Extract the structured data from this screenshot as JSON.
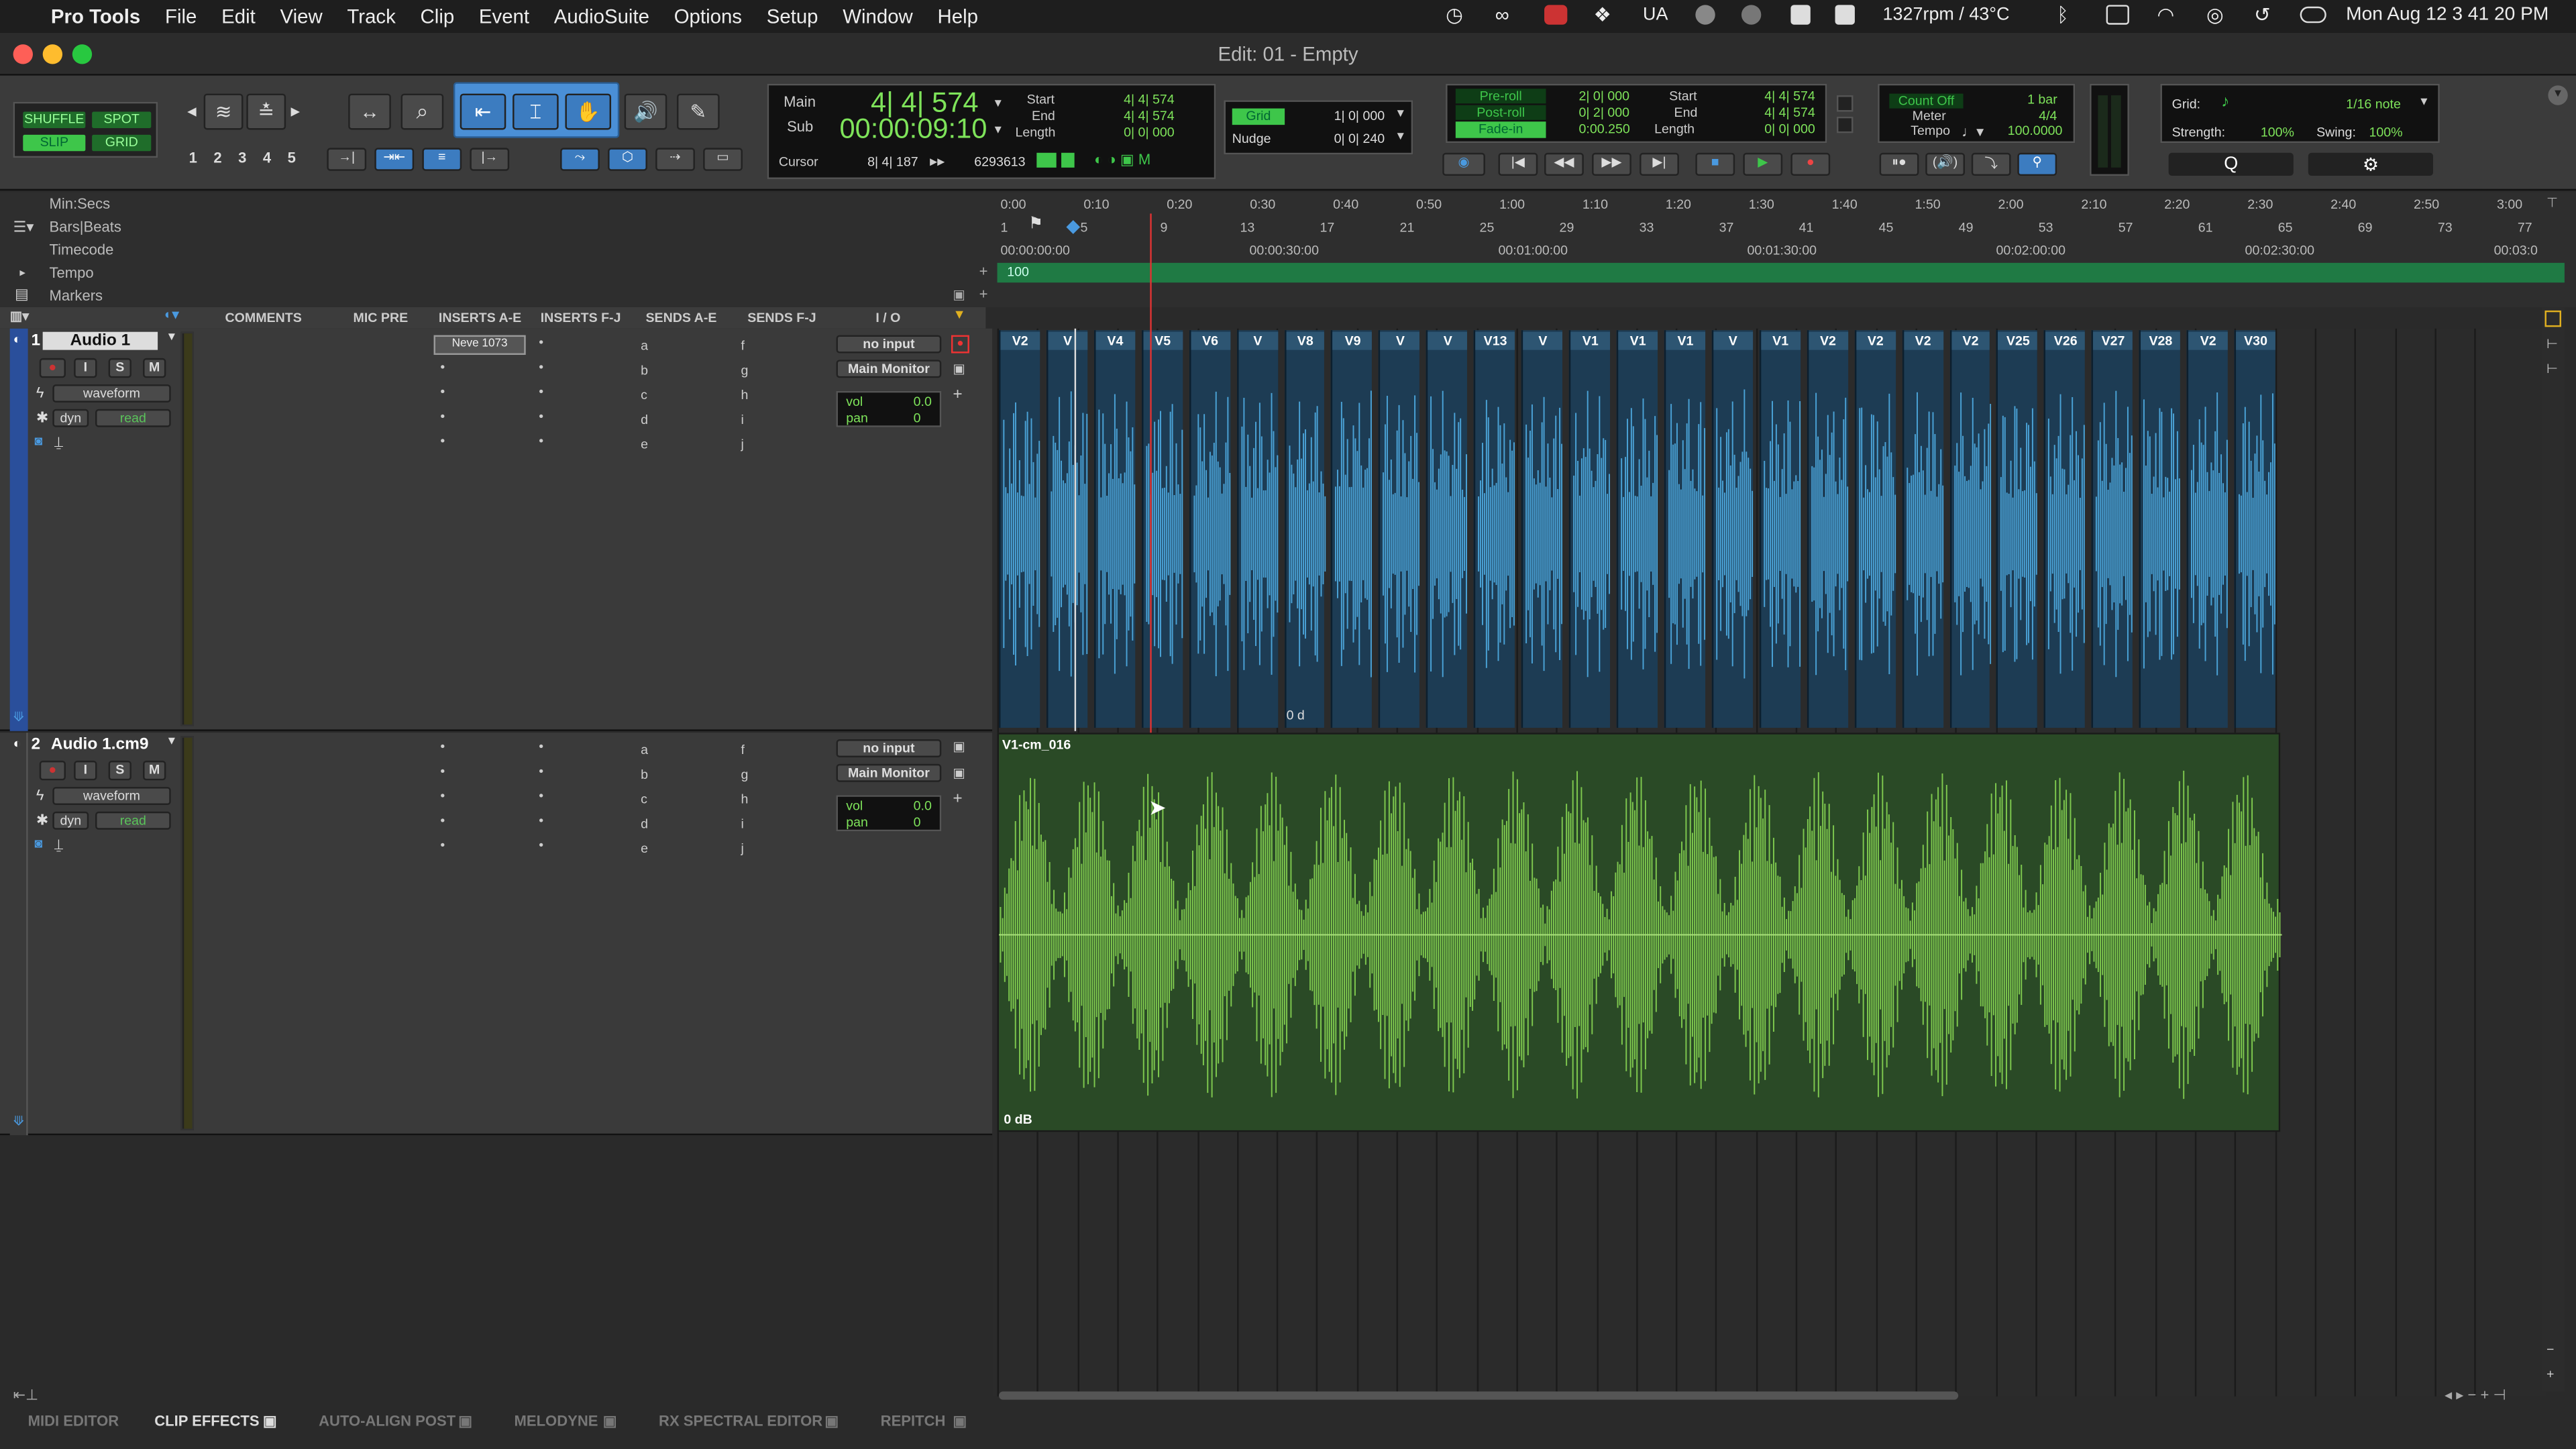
{
  "menubar": {
    "app": "Pro Tools",
    "items": [
      "File",
      "Edit",
      "View",
      "Track",
      "Clip",
      "Event",
      "AudioSuite",
      "Options",
      "Setup",
      "Window",
      "Help"
    ],
    "status": [
      "UA",
      "1327rpm / 43°C"
    ],
    "datetime": "Mon Aug 12  3 41 20 PM"
  },
  "window": {
    "title": "Edit: 01 - Empty"
  },
  "modes": {
    "shuffle": "SHUFFLE",
    "spot": "SPOT",
    "slip": "SLIP",
    "grid": "GRID"
  },
  "zoom_presets": [
    "1",
    "2",
    "3",
    "4",
    "5"
  ],
  "counter": {
    "main_label": "Main",
    "sub_label": "Sub",
    "main": "4| 4| 574",
    "sub": "00:00:09:10",
    "cursor_label": "Cursor",
    "cursor": "8| 4| 187",
    "cursor_value": "6293613"
  },
  "selection": {
    "start_label": "Start",
    "end_label": "End",
    "length_label": "Length",
    "start": "4| 4| 574",
    "end": "4| 4| 574",
    "length": "0| 0| 000"
  },
  "grid_nudge": {
    "grid_label": "Grid",
    "grid_value": "1| 0| 000",
    "nudge_label": "Nudge",
    "nudge_value": "0| 0| 240"
  },
  "preroll": {
    "pre_label": "Pre-roll",
    "post_label": "Post-roll",
    "fade_label": "Fade-in",
    "pre": "2| 0| 000",
    "post": "0| 2| 000",
    "fade": "0:00.250",
    "start_label": "Start",
    "end_label": "End",
    "length_label": "Length",
    "start": "4| 4| 574",
    "end": "4| 4| 574",
    "length": "0| 0| 000"
  },
  "countoff": {
    "count_label": "Count Off",
    "count_value": "1 bar",
    "meter_label": "Meter",
    "meter_value": "4/4",
    "tempo_label": "Tempo",
    "tempo_value": "100.0000"
  },
  "gridsettings": {
    "grid_label": "Grid:",
    "grid_value": "1/16 note",
    "strength_label": "Strength:",
    "strength_value": "100%",
    "swing_label": "Swing:",
    "swing_value": "100%"
  },
  "rulers": {
    "minsecs": "Min:Secs",
    "barsbeats": "Bars|Beats",
    "timecode": "Timecode",
    "tempo": "Tempo",
    "markers": "Markers",
    "tempo_marker": "100"
  },
  "minsecs_ticks": [
    "0:00",
    "0:10",
    "0:20",
    "0:30",
    "0:40",
    "0:50",
    "1:00",
    "1:10",
    "1:20",
    "1:30",
    "1:40",
    "1:50",
    "2:00",
    "2:10",
    "2:20",
    "2:30",
    "2:40",
    "2:50",
    "3:00"
  ],
  "bars_ticks": [
    "1",
    "5",
    "9",
    "13",
    "17",
    "21",
    "25",
    "29",
    "33",
    "37",
    "41",
    "45",
    "49",
    "53",
    "57",
    "61",
    "65",
    "69",
    "73",
    "77"
  ],
  "tc_ticks": [
    "00:00:00:00",
    "00:00:30:00",
    "00:01:00:00",
    "00:01:30:00",
    "00:02:00:00",
    "00:02:30:00",
    "00:03:0"
  ],
  "mix_header": {
    "comments": "COMMENTS",
    "micpre": "MIC PRE",
    "ins_ae": "INSERTS A-E",
    "ins_fj": "INSERTS F-J",
    "sends_ae": "SENDS A-E",
    "sends_fj": "SENDS F-J",
    "io": "I / O"
  },
  "tracks": [
    {
      "num": "1",
      "name": "Audio 1",
      "view": "waveform",
      "dyn": "dyn",
      "auto": "read",
      "insert": "Neve 1073",
      "sends_ae": [
        "a",
        "b",
        "c",
        "d",
        "e"
      ],
      "sends_fj": [
        "f",
        "g",
        "h",
        "i",
        "j"
      ],
      "input": "no input",
      "output": "Main Monitor",
      "vol_label": "vol",
      "vol": "0.0",
      "pan_label": "pan",
      "pan": "0",
      "clip_gain": "0 d"
    },
    {
      "num": "2",
      "name": "Audio 1.cm9",
      "view": "waveform",
      "dyn": "dyn",
      "auto": "read",
      "sends_ae": [
        "a",
        "b",
        "c",
        "d",
        "e"
      ],
      "sends_fj": [
        "f",
        "g",
        "h",
        "i",
        "j"
      ],
      "input": "no input",
      "output": "Main Monitor",
      "vol_label": "vol",
      "vol": "0.0",
      "pan_label": "pan",
      "pan": "0",
      "clip_name": "V1-cm_016",
      "clip_gain": "0 dB"
    }
  ],
  "clips_track1": [
    "V2",
    "V",
    "V4",
    "V5",
    "V6",
    "V",
    "V8",
    "V9",
    "V",
    "V",
    "V13",
    "V",
    "V1",
    "V1",
    "V1",
    "V",
    "V1",
    "V2",
    "V2",
    "V2",
    "V2",
    "V25",
    "V26",
    "V27",
    "V28",
    "V2",
    "V30"
  ],
  "bottom_tabs": [
    "MIDI EDITOR",
    "CLIP EFFECTS",
    "AUTO-ALIGN POST",
    "MELODYNE",
    "RX SPECTRAL EDITOR",
    "REPITCH"
  ],
  "colors": {
    "track1_clip": "#1d3c54",
    "track1_wave": "#4aa2d6",
    "track2_clip": "#2a4a26",
    "track2_wave": "#7ec84e",
    "counter_green": "#7ee35a"
  }
}
